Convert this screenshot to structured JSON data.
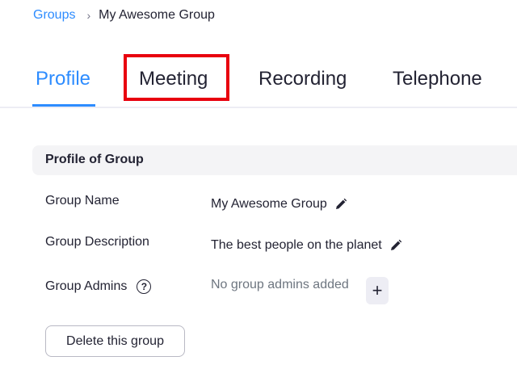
{
  "breadcrumb": {
    "parent": "Groups",
    "separator": "›",
    "current": "My Awesome Group"
  },
  "tabs": [
    {
      "label": "Profile",
      "active": true
    },
    {
      "label": "Meeting",
      "active": false,
      "highlighted": true
    },
    {
      "label": "Recording",
      "active": false
    },
    {
      "label": "Telephone",
      "active": false
    }
  ],
  "section": {
    "title": "Profile of Group",
    "rows": [
      {
        "label": "Group Name",
        "value": "My Awesome Group",
        "icon": "pencil-icon"
      },
      {
        "label": "Group Description",
        "value": "The best people on the planet",
        "icon": "pencil-icon"
      },
      {
        "label": "Group Admins",
        "value": "No group admins added",
        "icon": "help-icon"
      }
    ],
    "help_glyph": "?",
    "add_glyph": "+",
    "delete_label": "Delete this group"
  },
  "colors": {
    "accent": "#2d8cff",
    "highlight": "#e8000e",
    "section_bg": "#f4f4f6"
  }
}
